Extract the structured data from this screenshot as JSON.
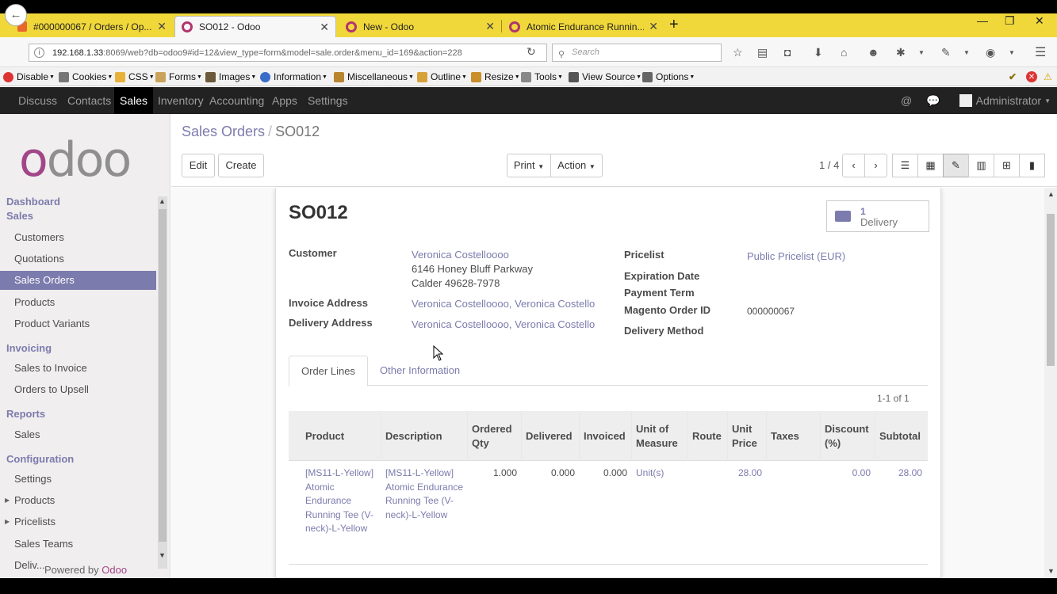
{
  "browser": {
    "tabs": [
      {
        "label": "#000000067 / Orders / Op..."
      },
      {
        "label": "SO012 - Odoo"
      },
      {
        "label": "New - Odoo"
      },
      {
        "label": "Atomic Endurance Runnin..."
      }
    ],
    "url_host": "192.168.1.33",
    "url_rest": ":8069/web?db=odoo9#id=12&view_type=form&model=sale.order&menu_id=169&action=228",
    "search_placeholder": "Search",
    "webdev_toolbar": [
      "Disable",
      "Cookies",
      "CSS",
      "Forms",
      "Images",
      "Information",
      "Miscellaneous",
      "Outline",
      "Resize",
      "Tools",
      "View Source",
      "Options"
    ]
  },
  "odoo_menu": {
    "items": [
      "Discuss",
      "Contacts",
      "Sales",
      "Inventory",
      "Accounting",
      "Apps",
      "Settings"
    ],
    "active": "Sales",
    "user": "Administrator"
  },
  "sidebar": {
    "logo_o": "o",
    "logo_rest": "doo",
    "dashboard": "Dashboard",
    "sales_header": "Sales",
    "sales_items": [
      "Customers",
      "Quotations",
      "Sales Orders",
      "Products",
      "Product Variants"
    ],
    "invoicing_header": "Invoicing",
    "invoicing_items": [
      "Sales to Invoice",
      "Orders to Upsell"
    ],
    "reports_header": "Reports",
    "reports_items": [
      "Sales"
    ],
    "config_header": "Configuration",
    "config_items": [
      "Settings",
      "Products",
      "Pricelists",
      "Sales Teams",
      "Deliv..."
    ],
    "powered_by": "Powered by",
    "powered_brand": "Odoo"
  },
  "control_panel": {
    "breadcrumb_parent": "Sales Orders",
    "breadcrumb_sep": "/",
    "breadcrumb_current": "SO012",
    "edit": "Edit",
    "create": "Create",
    "print": "Print",
    "action": "Action",
    "pager": "1 / 4"
  },
  "form": {
    "title": "SO012",
    "delivery_count": "1",
    "delivery_label": "Delivery",
    "customer_label": "Customer",
    "customer_name": "Veronica Costelloooo",
    "customer_addr1": "6146 Honey Bluff Parkway",
    "customer_addr2": "Calder 49628-7978",
    "invoice_label": "Invoice Address",
    "invoice_value": "Veronica Costelloooo, Veronica Costello",
    "delivery_addr_label": "Delivery Address",
    "delivery_addr_value": "Veronica Costelloooo, Veronica Costello",
    "pricelist_label": "Pricelist",
    "pricelist_value": "Public Pricelist (EUR)",
    "expiration_label": "Expiration Date",
    "payment_label": "Payment Term",
    "magento_label": "Magento Order ID",
    "magento_value": "000000067",
    "delivery_method_label": "Delivery Method",
    "tab_order_lines": "Order Lines",
    "tab_other": "Other Information",
    "record_pager": "1-1 of 1",
    "columns": [
      "Product",
      "Description",
      "Ordered Qty",
      "Delivered",
      "Invoiced",
      "Unit of Measure",
      "Route",
      "Unit Price",
      "Taxes",
      "Discount (%)",
      "Subtotal"
    ],
    "line": {
      "product": "[MS11-L-Yellow] Atomic Endurance Running Tee (V-neck)-L-Yellow",
      "description": "[MS11-L-Yellow] Atomic Endurance Running Tee (V-neck)-L-Yellow",
      "ordered_qty": "1.000",
      "delivered": "0.000",
      "invoiced": "0.000",
      "uom": "Unit(s)",
      "route": "",
      "unit_price": "28.00",
      "taxes": "",
      "discount": "0.00",
      "subtotal": "28.00"
    }
  }
}
